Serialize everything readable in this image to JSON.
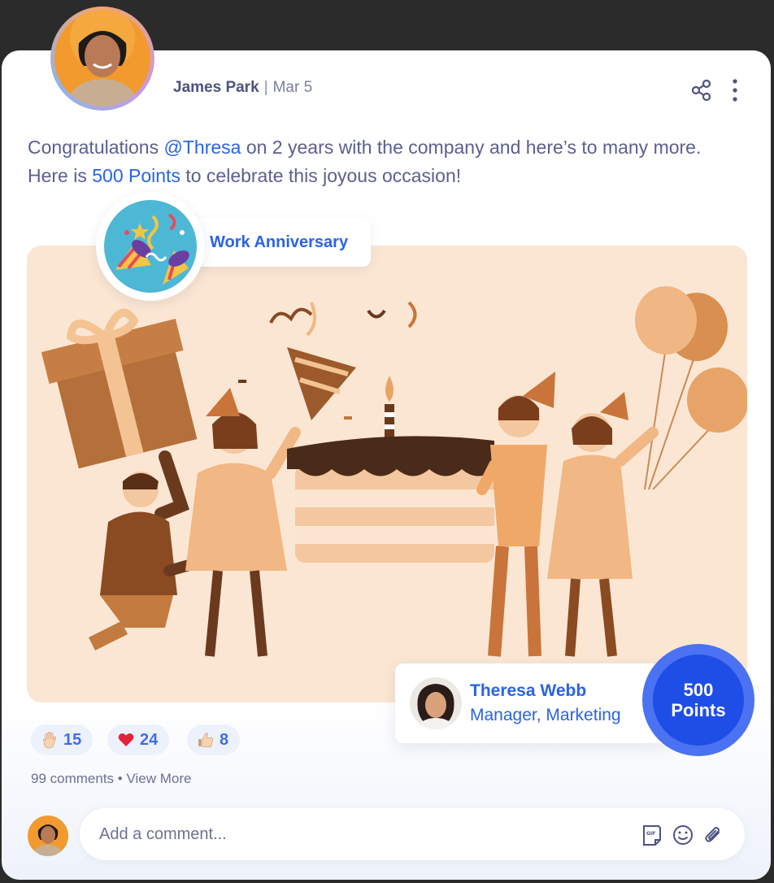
{
  "post": {
    "author_name": "James Park",
    "separator": "|",
    "date": "Mar 5",
    "message": {
      "part1": "Congratulations ",
      "mention": "@Thresa",
      "part2": " on 2 years with the company and here’s to many more. Here is ",
      "points_text": "500 Points",
      "part3": " to celebrate this joyous occasion!"
    }
  },
  "badge": {
    "label": "Work Anniversary",
    "icon": "party-popper-icon"
  },
  "recipient": {
    "name": "Theresa Webb",
    "role": "Manager, Marketing"
  },
  "points": {
    "value": "500",
    "label": "Points"
  },
  "reactions": [
    {
      "emoji": "raised-hand-icon",
      "count": "15"
    },
    {
      "emoji": "heart-icon",
      "count": "24"
    },
    {
      "emoji": "thumbs-up-icon",
      "count": "8"
    }
  ],
  "comments": {
    "count_text": "99 comments",
    "bullet": "•",
    "view_more": "View More"
  },
  "composer": {
    "placeholder": "Add a comment...",
    "icons": [
      "gif-icon",
      "emoji-icon",
      "attachment-icon"
    ]
  },
  "colors": {
    "accent": "#2a63e6",
    "text": "#5b5f8f",
    "scene_bg": "#fbe6d3",
    "points_bg": "#1f4ee6"
  }
}
